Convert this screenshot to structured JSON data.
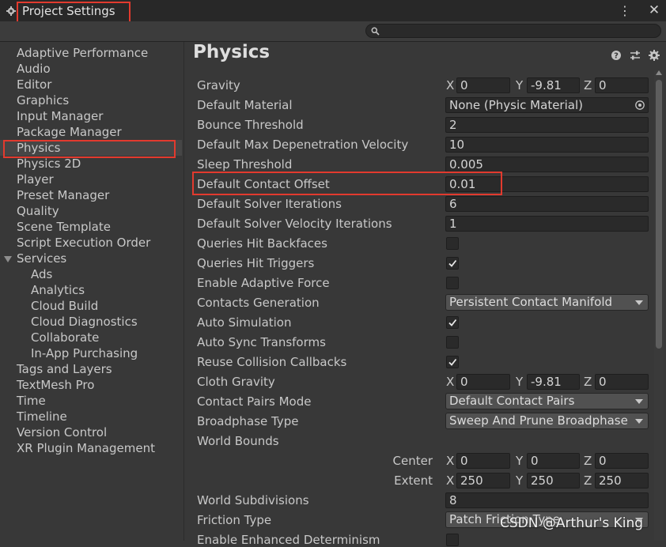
{
  "window": {
    "title": "Project Settings",
    "menu_glyph": "⋮",
    "close_glyph": "✕"
  },
  "search": {
    "placeholder": ""
  },
  "sidebar": {
    "items": [
      {
        "label": "Adaptive Performance",
        "indent": 0
      },
      {
        "label": "Audio",
        "indent": 0
      },
      {
        "label": "Editor",
        "indent": 0
      },
      {
        "label": "Graphics",
        "indent": 0
      },
      {
        "label": "Input Manager",
        "indent": 0
      },
      {
        "label": "Package Manager",
        "indent": 0
      },
      {
        "label": "Physics",
        "indent": 0,
        "selected": true
      },
      {
        "label": "Physics 2D",
        "indent": 0
      },
      {
        "label": "Player",
        "indent": 0
      },
      {
        "label": "Preset Manager",
        "indent": 0
      },
      {
        "label": "Quality",
        "indent": 0
      },
      {
        "label": "Scene Template",
        "indent": 0
      },
      {
        "label": "Script Execution Order",
        "indent": 0
      },
      {
        "label": "Services",
        "indent": 0,
        "expanded": true
      },
      {
        "label": "Ads",
        "indent": 1
      },
      {
        "label": "Analytics",
        "indent": 1
      },
      {
        "label": "Cloud Build",
        "indent": 1
      },
      {
        "label": "Cloud Diagnostics",
        "indent": 1
      },
      {
        "label": "Collaborate",
        "indent": 1
      },
      {
        "label": "In-App Purchasing",
        "indent": 1
      },
      {
        "label": "Tags and Layers",
        "indent": 0
      },
      {
        "label": "TextMesh Pro",
        "indent": 0
      },
      {
        "label": "Time",
        "indent": 0
      },
      {
        "label": "Timeline",
        "indent": 0
      },
      {
        "label": "Version Control",
        "indent": 0
      },
      {
        "label": "XR Plugin Management",
        "indent": 0
      }
    ]
  },
  "main": {
    "title": "Physics",
    "header_icons": [
      "help-icon",
      "presets-icon",
      "settings-icon"
    ],
    "rows": [
      {
        "label": "Gravity",
        "type": "vec3",
        "x": "0",
        "y": "-9.81",
        "z": "0"
      },
      {
        "label": "Default Material",
        "type": "object",
        "value": "None (Physic Material)"
      },
      {
        "label": "Bounce Threshold",
        "type": "text",
        "value": "2"
      },
      {
        "label": "Default Max Depenetration Velocity",
        "type": "text",
        "value": "10"
      },
      {
        "label": "Sleep Threshold",
        "type": "text",
        "value": "0.005"
      },
      {
        "label": "Default Contact Offset",
        "type": "text",
        "value": "0.01"
      },
      {
        "label": "Default Solver Iterations",
        "type": "text",
        "value": "6"
      },
      {
        "label": "Default Solver Velocity Iterations",
        "type": "text",
        "value": "1"
      },
      {
        "label": "Queries Hit Backfaces",
        "type": "check",
        "checked": false
      },
      {
        "label": "Queries Hit Triggers",
        "type": "check",
        "checked": true
      },
      {
        "label": "Enable Adaptive Force",
        "type": "check",
        "checked": false
      },
      {
        "label": "Contacts Generation",
        "type": "dropdown",
        "value": "Persistent Contact Manifold"
      },
      {
        "label": "Auto Simulation",
        "type": "check",
        "checked": true
      },
      {
        "label": "Auto Sync Transforms",
        "type": "check",
        "checked": false
      },
      {
        "label": "Reuse Collision Callbacks",
        "type": "check",
        "checked": true
      },
      {
        "label": "Cloth Gravity",
        "type": "vec3",
        "x": "0",
        "y": "-9.81",
        "z": "0"
      },
      {
        "label": "Contact Pairs Mode",
        "type": "dropdown",
        "value": "Default Contact Pairs"
      },
      {
        "label": "Broadphase Type",
        "type": "dropdown",
        "value": "Sweep And Prune Broadphase"
      },
      {
        "label": "World Bounds",
        "type": "header"
      },
      {
        "label": "Center",
        "type": "vec3",
        "sub": true,
        "x": "0",
        "y": "0",
        "z": "0"
      },
      {
        "label": "Extent",
        "type": "vec3",
        "sub": true,
        "x": "250",
        "y": "250",
        "z": "250"
      },
      {
        "label": "World Subdivisions",
        "type": "text",
        "value": "8"
      },
      {
        "label": "Friction Type",
        "type": "dropdown",
        "value": "Patch Friction Type"
      },
      {
        "label": "Enable Enhanced Determinism",
        "type": "check",
        "checked": false
      }
    ],
    "axis_labels": {
      "x": "X",
      "y": "Y",
      "z": "Z"
    }
  },
  "watermark": "CSDN @Arthur's King",
  "colors": {
    "highlight_red": "#e23a2e",
    "panel_bg": "#383838",
    "field_bg": "#2a2a2a",
    "selected_bg": "#464646"
  }
}
